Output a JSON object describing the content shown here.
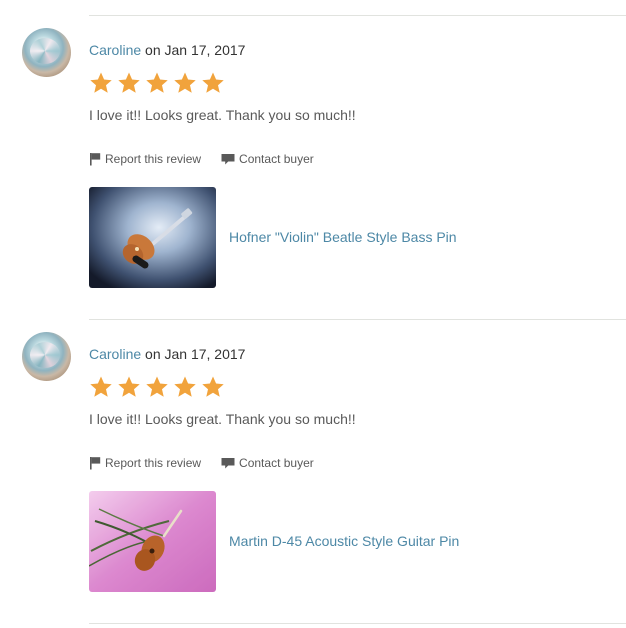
{
  "reviews": [
    {
      "reviewer": "Caroline",
      "date_text": " on Jan 17, 2017",
      "rating": 5,
      "text": "I love it!! Looks great. Thank you so much!!",
      "report_label": "Report this review",
      "contact_label": "Contact buyer",
      "listing_title": "Hofner \"Violin\" Beatle Style Bass Pin"
    },
    {
      "reviewer": "Caroline",
      "date_text": " on Jan 17, 2017",
      "rating": 5,
      "text": "I love it!! Looks great. Thank you so much!!",
      "report_label": "Report this review",
      "contact_label": "Contact buyer",
      "listing_title": "Martin D-45 Acoustic Style Guitar Pin"
    }
  ],
  "colors": {
    "link": "#4d88a6",
    "star": "#f1a33c",
    "divider": "#e1e3df"
  },
  "icons": [
    "star-icon",
    "flag-icon",
    "chat-icon"
  ]
}
